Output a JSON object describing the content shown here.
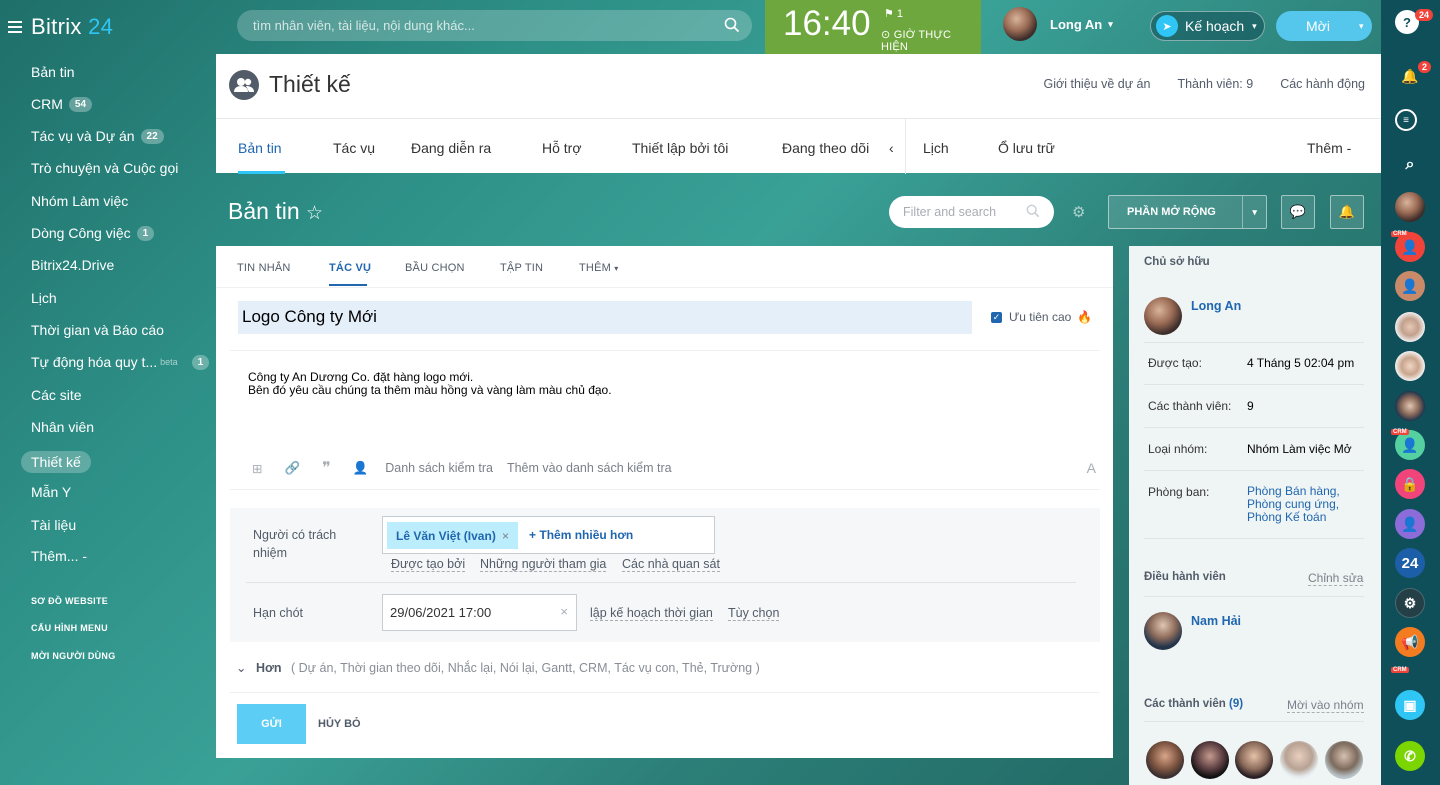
{
  "app": {
    "logo_main": "Bitrix",
    "logo_num": " 24"
  },
  "header": {
    "search_placeholder": "tìm nhân viên, tài liệu, nội dung khác...",
    "clock": "16:40",
    "flag_count": "1",
    "work_time": "GIỜ THỰC HIỆN",
    "user_name": "Long An",
    "plan_label": "Kế hoạch",
    "invite_label": "Mời"
  },
  "menu": {
    "items": [
      {
        "label": "Bản tin"
      },
      {
        "label": "CRM",
        "badge": "54"
      },
      {
        "label": "Tác vụ và Dự án",
        "badge": "22"
      },
      {
        "label": "Trò chuyện và Cuộc gọi"
      },
      {
        "label": "Nhóm Làm việc"
      },
      {
        "label": "Dòng Công việc",
        "badge": "1"
      },
      {
        "label": "Bitrix24.Drive"
      },
      {
        "label": "Lịch"
      },
      {
        "label": "Thời gian và Báo cáo"
      },
      {
        "label": "Tự động hóa quy t...",
        "badge": "1",
        "beta": "beta"
      },
      {
        "label": "Các site"
      },
      {
        "label": "Nhân viên"
      },
      {
        "label": "Thiết kế"
      },
      {
        "label": "Mẫn Y"
      },
      {
        "label": "Tài liệu"
      },
      {
        "label": "Thêm... -"
      }
    ],
    "small_links": [
      "SƠ ĐỒ WEBSITE",
      "CẤU HÌNH MENU",
      "MỜI NGƯỜI DÙNG"
    ]
  },
  "right_bar": {
    "help_badge": "24",
    "notif_badge": "2",
    "crm_tag": "CRM",
    "counter": "24"
  },
  "project": {
    "title": "Thiết kế",
    "links": [
      "Giới thiệu về dự án",
      "Thành viên: 9",
      "Các hành động"
    ],
    "tabs": [
      "Bản tin",
      "Tác vụ",
      "Đang diễn ra",
      "Hỗ trợ",
      "Thiết lập bởi tôi",
      "Đang theo dõi",
      "‹",
      "Lịch",
      "Ổ lưu trữ",
      "Thêm -"
    ]
  },
  "feed": {
    "title": "Bản tin",
    "filter_placeholder": "Filter and search",
    "ext_label": "PHẦN MỞ RỘNG"
  },
  "composer": {
    "tabs": [
      "TIN NHẮN",
      "TÁC VỤ",
      "BẦU CHỌN",
      "TẬP TIN",
      "THÊM"
    ],
    "task_title": "Logo Công ty Mới",
    "priority": "Ưu tiên cao",
    "desc1": "Công ty An Dương Co. đặt hàng logo mới.",
    "desc2": "Bên đó yêu cầu chúng ta thêm màu hồng và vàng làm màu chủ đạo.",
    "checklist": "Danh sách kiểm tra",
    "add_checklist": "Thêm vào danh sách kiểm tra",
    "font_btn": "A",
    "responsible_label": "Người có trách nhiệm",
    "responsible_chip": "Lê Văn Việt (Ivan)",
    "add_more": "Thêm nhiều hơn",
    "created_by": "Được tạo bởi",
    "participants": "Những người tham gia",
    "observers": "Các nhà quan sát",
    "deadline_label": "Hạn chót",
    "deadline_value": "29/06/2021 17:00",
    "plan_time": "lập kế hoạch thời gian",
    "options": "Tùy chọn",
    "more_label": "Hơn",
    "more_items": "( Dự án,  Thời gian theo dõi,  Nhắc lại,  Nói lại,  Gantt,  CRM,  Tác vụ con,  Thẻ,  Trường )",
    "send": "GỬI",
    "cancel": "HỦY BỎ"
  },
  "panel": {
    "owner_heading": "Chủ sở hữu",
    "owner_name": "Long An",
    "rows": [
      {
        "k": "Được tạo:",
        "v": "4 Tháng 5 02:04 pm"
      },
      {
        "k": "Các thành viên:",
        "v": "9"
      },
      {
        "k": "Loại nhóm:",
        "v": "Nhóm Làm việc Mở"
      },
      {
        "k": "Phòng ban:",
        "v1": "Phòng Bán hàng,",
        "v2": "Phòng cung ứng,",
        "v3": "Phòng Kế toán"
      }
    ],
    "moderators_heading": "Điều hành viên",
    "edit": "Chỉnh sửa",
    "moderator_name": "Nam Hải",
    "members_heading": "Các thành viên",
    "members_count": "(9)",
    "invite": "Mời vào nhóm"
  },
  "colors": {
    "accent": "#2fc6f6",
    "link": "#2067b0",
    "clock_bg": "#6ea73d"
  }
}
